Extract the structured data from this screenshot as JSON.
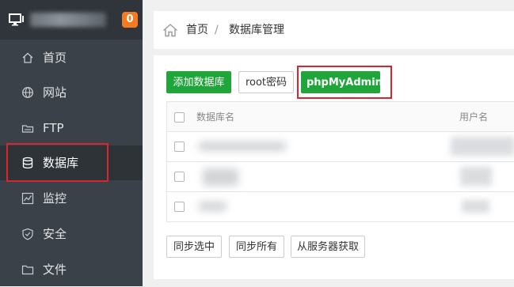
{
  "sidebar": {
    "badge": "0",
    "items": [
      {
        "label": "首页",
        "icon": "home-icon"
      },
      {
        "label": "网站",
        "icon": "globe-icon"
      },
      {
        "label": "FTP",
        "icon": "ftp-icon"
      },
      {
        "label": "数据库",
        "icon": "database-icon"
      },
      {
        "label": "监控",
        "icon": "monitor-chart-icon"
      },
      {
        "label": "安全",
        "icon": "shield-icon"
      },
      {
        "label": "文件",
        "icon": "folder-icon"
      }
    ],
    "active_index": 3
  },
  "breadcrumb": {
    "home": "首页",
    "separator": "/",
    "current": "数据库管理"
  },
  "toolbar": {
    "add_db": "添加数据库",
    "root_password": "root密码",
    "phpmyadmin": "phpMyAdmin"
  },
  "table": {
    "columns": [
      "数据库名",
      "用户名"
    ]
  },
  "footer": {
    "sync_selected": "同步选中",
    "sync_all": "同步所有",
    "fetch_from_server": "从服务器获取"
  },
  "colors": {
    "sidebar_bg": "#3b4148",
    "accent_green": "#20a53a",
    "badge_orange": "#f47b20",
    "highlight_red": "#d9262c"
  }
}
